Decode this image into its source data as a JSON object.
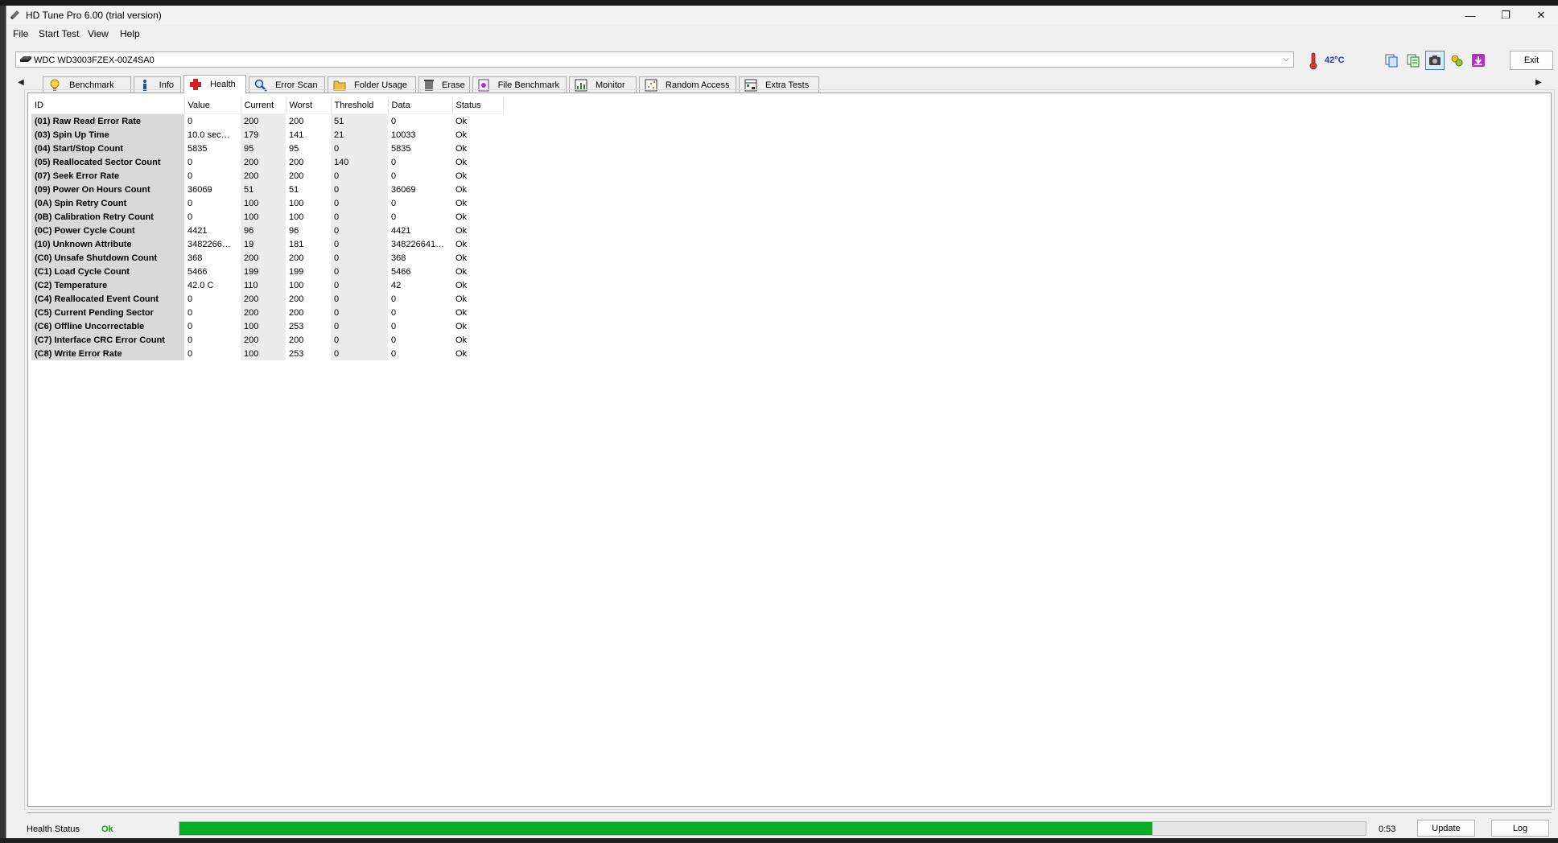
{
  "window": {
    "title": "HD Tune Pro 6.00 (trial version)",
    "controls": {
      "minimize": "—",
      "restore": "❐",
      "close": "✕"
    }
  },
  "menu": [
    "File",
    "Start Test",
    "View",
    "Help"
  ],
  "drive": {
    "selected": "WDC WD3003FZEX-00Z4SA0"
  },
  "temperature": {
    "value": "42°C",
    "color": "#1c3fd6"
  },
  "toolbar": {
    "icons": [
      "copy-info-icon",
      "copy-text-icon",
      "screenshot-icon",
      "options-icon",
      "save-icon"
    ],
    "exit_label": "Exit"
  },
  "tabs": [
    {
      "label": "Benchmark",
      "icon": "lightbulb-icon"
    },
    {
      "label": "Info",
      "icon": "info-icon"
    },
    {
      "label": "Health",
      "icon": "health-cross-icon",
      "active": true
    },
    {
      "label": "Error Scan",
      "icon": "magnifier-icon"
    },
    {
      "label": "Folder Usage",
      "icon": "folder-icon"
    },
    {
      "label": "Erase",
      "icon": "trash-icon"
    },
    {
      "label": "File Benchmark",
      "icon": "file-benchmark-icon"
    },
    {
      "label": "Monitor",
      "icon": "monitor-chart-icon"
    },
    {
      "label": "Random Access",
      "icon": "random-access-icon"
    },
    {
      "label": "Extra Tests",
      "icon": "extra-tests-icon"
    }
  ],
  "table": {
    "headers": [
      "ID",
      "Value",
      "Current",
      "Worst",
      "Threshold",
      "Data",
      "Status"
    ],
    "rows": [
      [
        "(01) Raw Read Error Rate",
        "0",
        "200",
        "200",
        "51",
        "0",
        "Ok"
      ],
      [
        "(03) Spin Up Time",
        "10.0 sec…",
        "179",
        "141",
        "21",
        "10033",
        "Ok"
      ],
      [
        "(04) Start/Stop Count",
        "5835",
        "95",
        "95",
        "0",
        "5835",
        "Ok"
      ],
      [
        "(05) Reallocated Sector Count",
        "0",
        "200",
        "200",
        "140",
        "0",
        "Ok"
      ],
      [
        "(07) Seek Error Rate",
        "0",
        "200",
        "200",
        "0",
        "0",
        "Ok"
      ],
      [
        "(09) Power On Hours Count",
        "36069",
        "51",
        "51",
        "0",
        "36069",
        "Ok"
      ],
      [
        "(0A) Spin Retry Count",
        "0",
        "100",
        "100",
        "0",
        "0",
        "Ok"
      ],
      [
        "(0B) Calibration Retry Count",
        "0",
        "100",
        "100",
        "0",
        "0",
        "Ok"
      ],
      [
        "(0C) Power Cycle Count",
        "4421",
        "96",
        "96",
        "0",
        "4421",
        "Ok"
      ],
      [
        "(10) Unknown Attribute",
        "3482266…",
        "19",
        "181",
        "0",
        "348226641…",
        "Ok"
      ],
      [
        "(C0) Unsafe Shutdown Count",
        "368",
        "200",
        "200",
        "0",
        "368",
        "Ok"
      ],
      [
        "(C1) Load Cycle Count",
        "5466",
        "199",
        "199",
        "0",
        "5466",
        "Ok"
      ],
      [
        "(C2) Temperature",
        "42.0 C",
        "110",
        "100",
        "0",
        "42",
        "Ok"
      ],
      [
        "(C4) Reallocated Event Count",
        "0",
        "200",
        "200",
        "0",
        "0",
        "Ok"
      ],
      [
        "(C5) Current Pending Sector",
        "0",
        "200",
        "200",
        "0",
        "0",
        "Ok"
      ],
      [
        "(C6) Offline Uncorrectable",
        "0",
        "100",
        "253",
        "0",
        "0",
        "Ok"
      ],
      [
        "(C7) Interface CRC Error Count",
        "0",
        "200",
        "200",
        "0",
        "0",
        "Ok"
      ],
      [
        "(C8) Write Error Rate",
        "0",
        "100",
        "253",
        "0",
        "0",
        "Ok"
      ]
    ]
  },
  "footer": {
    "health_label": "Health Status",
    "health_value": "Ok",
    "health_color": "#11a311",
    "progress_fraction": 0.82,
    "time": "0:53",
    "update_label": "Update",
    "log_label": "Log"
  }
}
